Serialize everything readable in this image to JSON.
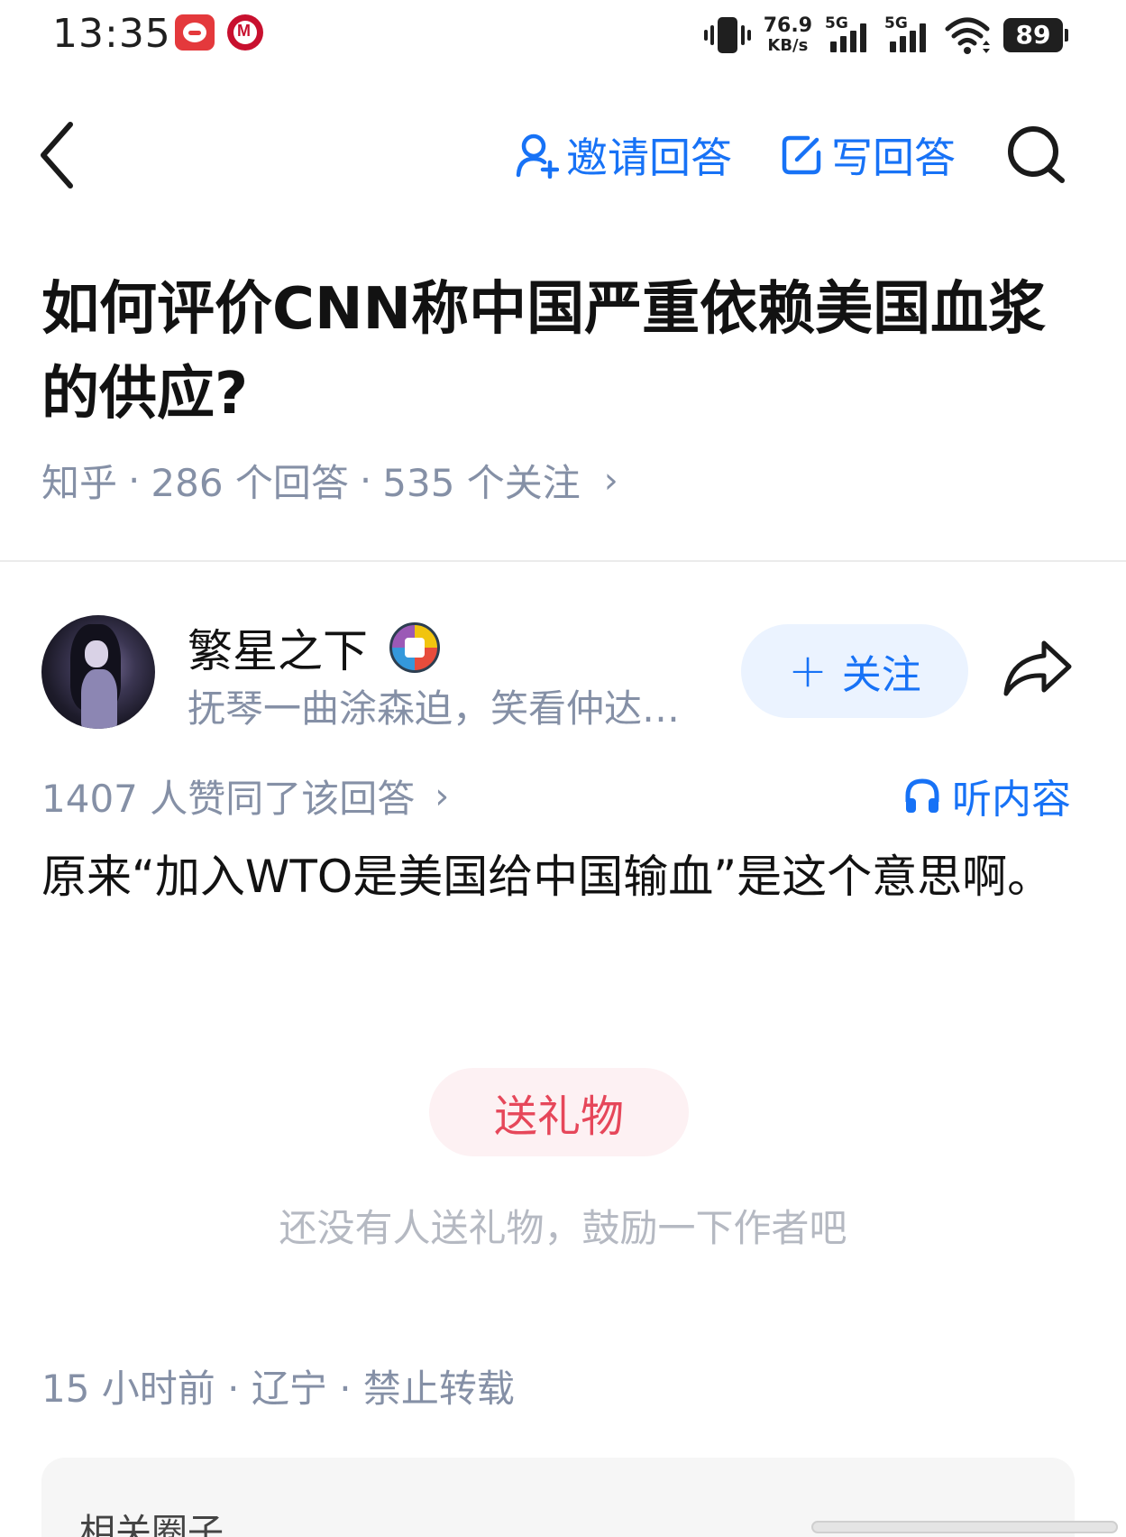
{
  "status_bar": {
    "time": "13:35",
    "net_speed_value": "76.9",
    "net_speed_unit": "KB/s",
    "sim1_label": "5G",
    "sim2_label": "5G",
    "battery": "89",
    "app_icons": [
      "jd-app-icon",
      "cmb-bank-icon"
    ]
  },
  "nav": {
    "invite_label": "邀请回答",
    "write_label": "写回答"
  },
  "question": {
    "title": "如何评价CNN称中国严重依赖美国血浆的供应?",
    "source": "知乎",
    "answers": "286 个回答",
    "followers": "535 个关注"
  },
  "author": {
    "name": "繁星之下",
    "bio": "抚琴一曲涂森迫，笑看仲达…",
    "follow_label": "关注"
  },
  "answer": {
    "votes": "1407 人赞同了该回答",
    "listen_label": "听内容",
    "content": "原来“加入WTO是美国给中国输血”是这个意思啊。"
  },
  "gift": {
    "button_label": "送礼物",
    "note": "还没有人送礼物，鼓励一下作者吧"
  },
  "footer": {
    "meta": "15 小时前 · 辽宁 · 禁止转载"
  },
  "related": {
    "title": "相关圈子"
  },
  "colors": {
    "accent": "#1772f6",
    "gift": "#e6475a",
    "muted": "#8590a6"
  }
}
